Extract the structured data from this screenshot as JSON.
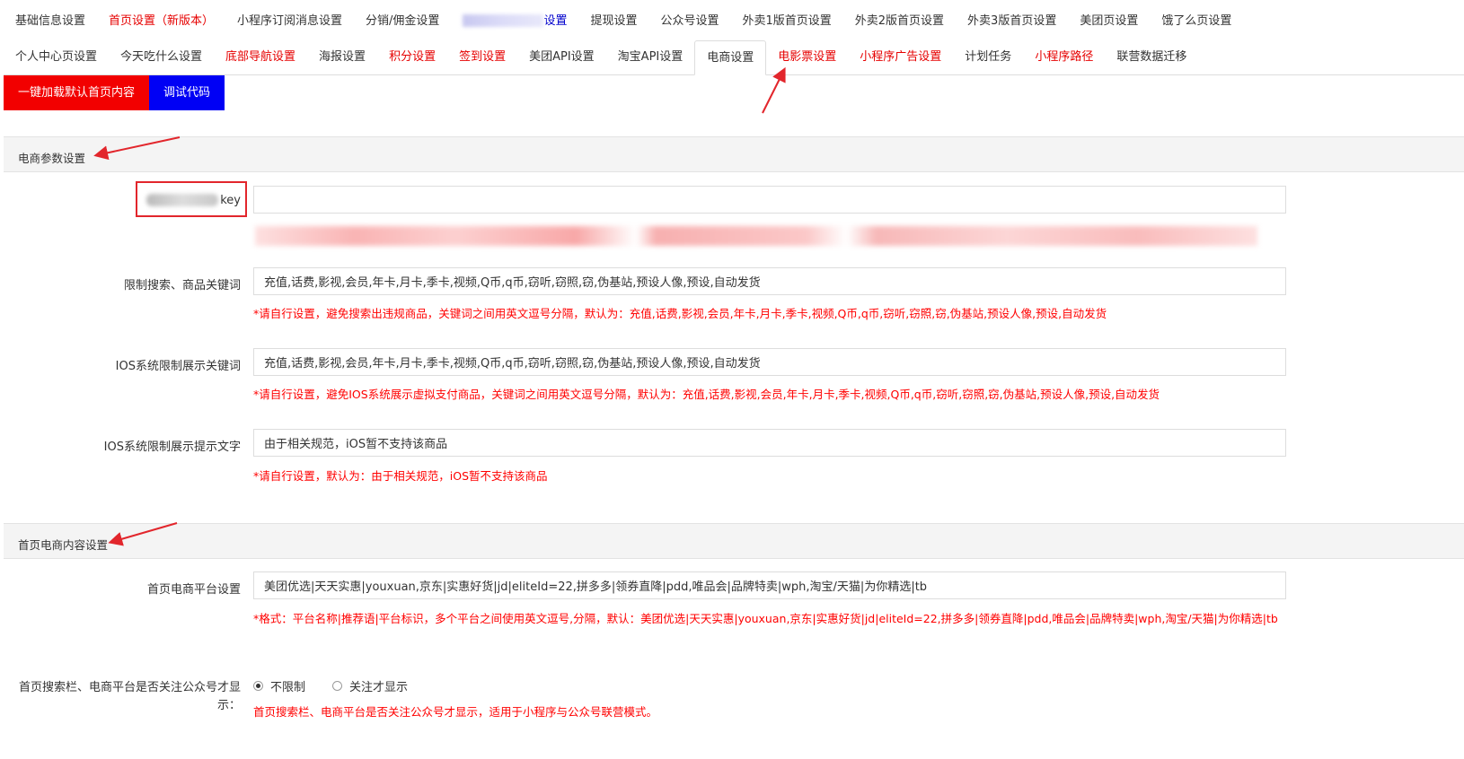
{
  "tabs_row1": [
    {
      "label": "基础信息设置",
      "style": "normal"
    },
    {
      "label": "首页设置（新版本）",
      "style": "red"
    },
    {
      "label": "小程序订阅消息设置",
      "style": "normal"
    },
    {
      "label": "分销/佣金设置",
      "style": "normal"
    },
    {
      "label": "设置",
      "style": "blue",
      "blurred_prefix": true
    },
    {
      "label": "提现设置",
      "style": "normal"
    },
    {
      "label": "公众号设置",
      "style": "normal"
    },
    {
      "label": "外卖1版首页设置",
      "style": "normal"
    },
    {
      "label": "外卖2版首页设置",
      "style": "normal"
    },
    {
      "label": "外卖3版首页设置",
      "style": "normal"
    },
    {
      "label": "美团页设置",
      "style": "normal"
    },
    {
      "label": "饿了么页设置",
      "style": "normal"
    }
  ],
  "tabs_row2": [
    {
      "label": "个人中心页设置",
      "style": "normal"
    },
    {
      "label": "今天吃什么设置",
      "style": "normal"
    },
    {
      "label": "底部导航设置",
      "style": "red"
    },
    {
      "label": "海报设置",
      "style": "normal"
    },
    {
      "label": "积分设置",
      "style": "red"
    },
    {
      "label": "签到设置",
      "style": "red"
    },
    {
      "label": "美团API设置",
      "style": "normal"
    },
    {
      "label": "淘宝API设置",
      "style": "normal"
    },
    {
      "label": "电商设置",
      "style": "active"
    },
    {
      "label": "电影票设置",
      "style": "red"
    },
    {
      "label": "小程序广告设置",
      "style": "red"
    },
    {
      "label": "计划任务",
      "style": "normal"
    },
    {
      "label": "小程序路径",
      "style": "red"
    },
    {
      "label": "联营数据迁移",
      "style": "normal"
    }
  ],
  "buttons": {
    "load_default": "一键加载默认首页内容",
    "debug_code": "调试代码"
  },
  "section1": {
    "title": "电商参数设置",
    "key_label": "key",
    "key_value": "",
    "keywords_label": "限制搜索、商品关键词",
    "keywords_value": "充值,话费,影视,会员,年卡,月卡,季卡,视频,Q币,q币,窃听,窃照,窃,伪基站,预设人像,预设,自动发货",
    "keywords_hint": "*请自行设置，避免搜索出违规商品，关键词之间用英文逗号分隔，默认为：充值,话费,影视,会员,年卡,月卡,季卡,视频,Q币,q币,窃听,窃照,窃,伪基站,预设人像,预设,自动发货",
    "ios_keywords_label": "IOS系统限制展示关键词",
    "ios_keywords_value": "充值,话费,影视,会员,年卡,月卡,季卡,视频,Q币,q币,窃听,窃照,窃,伪基站,预设人像,预设,自动发货",
    "ios_keywords_hint": "*请自行设置，避免IOS系统展示虚拟支付商品，关键词之间用英文逗号分隔，默认为：充值,话费,影视,会员,年卡,月卡,季卡,视频,Q币,q币,窃听,窃照,窃,伪基站,预设人像,预设,自动发货",
    "ios_tip_label": "IOS系统限制展示提示文字",
    "ios_tip_value": "由于相关规范，iOS暂不支持该商品",
    "ios_tip_hint": "*请自行设置，默认为：由于相关规范，iOS暂不支持该商品"
  },
  "section2": {
    "title": "首页电商内容设置",
    "platform_label": "首页电商平台设置",
    "platform_value": "美团优选|天天实惠|youxuan,京东|实惠好货|jd|eliteId=22,拼多多|领券直降|pdd,唯品会|品牌特卖|wph,淘宝/天猫|为你精选|tb",
    "platform_hint": "*格式：平台名称|推荐语|平台标识，多个平台之间使用英文逗号,分隔，默认：美团优选|天天实惠|youxuan,京东|实惠好货|jd|eliteId=22,拼多多|领券直降|pdd,唯品会|品牌特卖|wph,淘宝/天猫|为你精选|tb",
    "follow_label_line1": "首页搜索栏、电商平台是否关注公众号才显",
    "follow_label_line2": "示：",
    "follow_options": [
      {
        "label": "不限制",
        "checked": true
      },
      {
        "label": "关注才显示",
        "checked": false
      }
    ],
    "follow_hint": "首页搜索栏、电商平台是否关注公众号才显示，适用于小程序与公众号联营模式。"
  },
  "colors": {
    "accent_red": "#f20000",
    "accent_blue": "#0000f5",
    "hint_red": "#ff0000",
    "annotation_red": "#e2262c"
  }
}
